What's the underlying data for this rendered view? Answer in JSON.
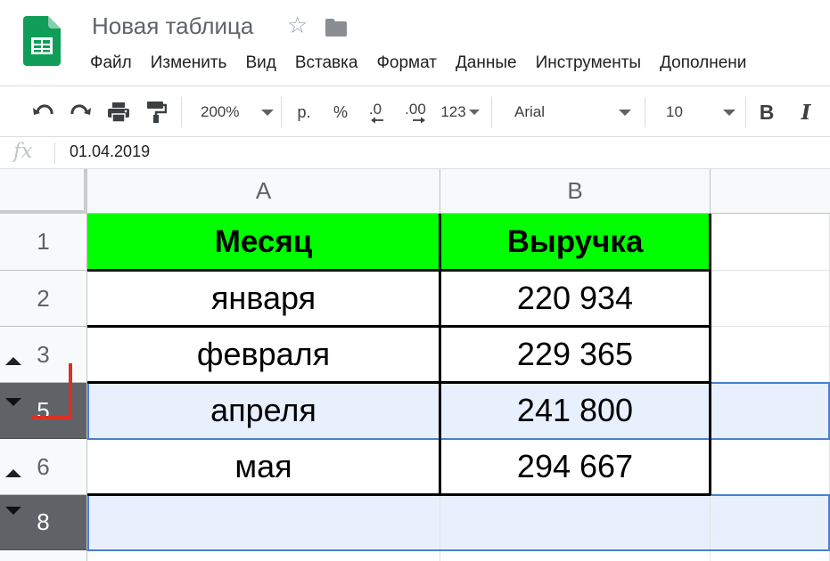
{
  "app": {
    "doc_title": "Новая таблица",
    "logo_icon": "google-sheets-logo",
    "star_icon": "☆",
    "folder_icon": "folder-icon"
  },
  "menu": {
    "items": [
      "Файл",
      "Изменить",
      "Вид",
      "Вставка",
      "Формат",
      "Данные",
      "Инструменты",
      "Дополнени"
    ]
  },
  "toolbar": {
    "undo_icon": "undo-icon",
    "redo_icon": "redo-icon",
    "print_icon": "print-icon",
    "paint_format_icon": "paint-format-icon",
    "zoom": "200%",
    "currency": "р.",
    "percent": "%",
    "decrease_decimal": ".0",
    "increase_decimal": ".00",
    "number_format": "123",
    "font": "Arial",
    "font_size": "10",
    "bold": "B",
    "italic": "I"
  },
  "formula_bar": {
    "fx_label": "fx",
    "value": "01.04.2019"
  },
  "sheet": {
    "columns": [
      "A",
      "B"
    ],
    "rows": [
      {
        "num": "1",
        "a": "Месяц",
        "b": "Выручка",
        "header": true
      },
      {
        "num": "2",
        "a": "января",
        "b": "220 934"
      },
      {
        "num": "3",
        "a": "февраля",
        "b": "229 365",
        "group": "expand"
      },
      {
        "num": "5",
        "a": "апреля",
        "b": "241 800",
        "group": "collapse",
        "selected": true
      },
      {
        "num": "6",
        "a": "мая",
        "b": "294 667",
        "group": "expand"
      },
      {
        "num": "8",
        "a": "",
        "b": "",
        "group": "collapse",
        "selected": true
      }
    ],
    "colors": {
      "header_fill": "#00ff00",
      "selection_fill": "#e8f0fe",
      "selection_border": "#4a7fd1",
      "annotation_mark": "#d93025",
      "dark_row_header": "#5f6368"
    }
  }
}
